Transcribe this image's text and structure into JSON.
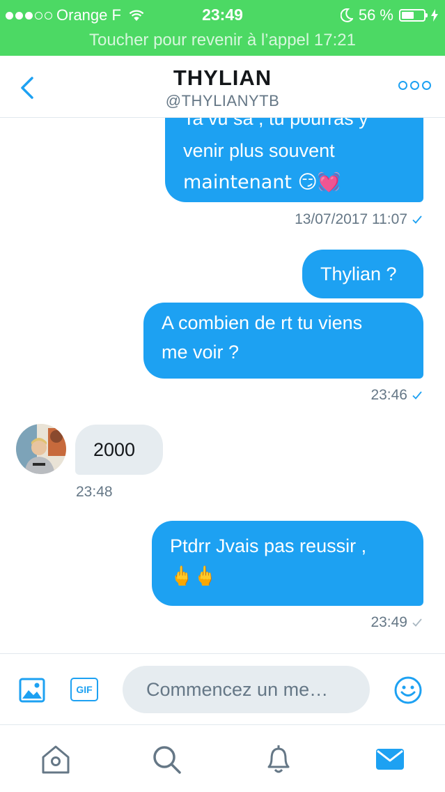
{
  "colors": {
    "call_green": "#4cd964",
    "accent_blue": "#1da1f2",
    "incoming_bubble": "#e6ecf0",
    "secondary_text": "#657786"
  },
  "status_bar": {
    "signal_bars_filled": 3,
    "signal_bars_total": 5,
    "carrier": "Orange F",
    "time": "23:49",
    "battery": "56 %",
    "battery_fraction": 0.56,
    "icons": [
      "wifi-icon",
      "moon-icon",
      "battery-icon",
      "charging-bolt-icon"
    ]
  },
  "call_banner": {
    "text": "Toucher pour revenir à l’appel 17:21"
  },
  "header": {
    "title": "THYLIAN",
    "handle": "@THYLIANYTB",
    "icons": [
      "chevron-left-icon",
      "more-options-icon"
    ]
  },
  "messages": [
    {
      "direction": "outgoing",
      "lines": [
        "Ta vu sa , tu pourras y",
        "venir plus souvent",
        "maintenant 😏💓"
      ]
    },
    {
      "timestamp": "13/07/2017 11:07",
      "status": "read"
    },
    {
      "direction": "outgoing",
      "lines": [
        "Thylian ?"
      ]
    },
    {
      "direction": "outgoing",
      "lines": [
        "A combien de rt tu viens",
        "me voir ?"
      ]
    },
    {
      "timestamp": "23:46",
      "status": "read"
    },
    {
      "direction": "incoming",
      "lines": [
        "2000"
      ]
    },
    {
      "timestamp": "23:48"
    },
    {
      "direction": "outgoing",
      "lines": [
        "Ptdrr Jvais pas reussir ,",
        "🖕🖕"
      ]
    },
    {
      "timestamp": "23:49",
      "status": "sent"
    }
  ],
  "composer": {
    "gif_label": "GIF",
    "placeholder": "Commencez un me…",
    "icons": [
      "image-icon",
      "gif-icon",
      "emoji-icon"
    ]
  },
  "tabbar": {
    "tabs": [
      "home-icon",
      "search-icon",
      "notifications-icon",
      "messages-icon"
    ],
    "active": "messages-icon"
  }
}
